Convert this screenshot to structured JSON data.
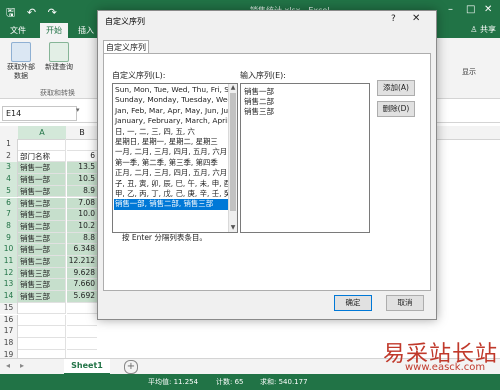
{
  "titlebar": {
    "document_title": "销售统计.xlsx - Excel",
    "qat_icons": [
      "save-icon",
      "undo-icon",
      "redo-icon"
    ]
  },
  "ribbon": {
    "tabs": [
      "文件",
      "开始",
      "插入"
    ],
    "active_tab": "开始",
    "share_label": "共享",
    "buttons": [
      "获取外部数据",
      "新建查询"
    ],
    "group_label": "获取和转换",
    "right_label": "显示"
  },
  "formula_bar": {
    "name_box": "E14"
  },
  "sheet": {
    "col_a_header": "A",
    "col_b_header": "B",
    "rows": [
      {
        "n": "1",
        "a": "",
        "b": ""
      },
      {
        "n": "2",
        "a": "部门名称",
        "b": "6"
      },
      {
        "n": "3",
        "a": "销售一部",
        "b": "13.5"
      },
      {
        "n": "4",
        "a": "销售一部",
        "b": "10.5"
      },
      {
        "n": "5",
        "a": "销售一部",
        "b": "8.9"
      },
      {
        "n": "6",
        "a": "销售二部",
        "b": "7.08"
      },
      {
        "n": "7",
        "a": "销售二部",
        "b": "10.0"
      },
      {
        "n": "8",
        "a": "销售二部",
        "b": "10.2"
      },
      {
        "n": "9",
        "a": "销售二部",
        "b": "8.8"
      },
      {
        "n": "10",
        "a": "销售一部",
        "b": "6.348"
      },
      {
        "n": "11",
        "a": "销售二部",
        "b": "12.212"
      },
      {
        "n": "12",
        "a": "销售三部",
        "b": "9.628"
      },
      {
        "n": "13",
        "a": "销售三部",
        "b": "7.660"
      },
      {
        "n": "14",
        "a": "销售三部",
        "b": "5.692"
      },
      {
        "n": "15",
        "a": "",
        "b": ""
      },
      {
        "n": "16",
        "a": "",
        "b": ""
      },
      {
        "n": "17",
        "a": "",
        "b": ""
      },
      {
        "n": "18",
        "a": "",
        "b": ""
      },
      {
        "n": "19",
        "a": "",
        "b": ""
      }
    ],
    "sheet_tab": "Sheet1",
    "add_sheet": "+"
  },
  "status": {
    "average": "平均值: 11.254",
    "count": "计数: 65",
    "sum": "求和: 540.177"
  },
  "dialog": {
    "title": "自定义序列",
    "help": "?",
    "close": "✕",
    "tab_label": "自定义序列",
    "lists_label": "自定义序列(L):",
    "entries_label": "输入序列(E):",
    "lists": [
      "Sun, Mon, Tue, Wed, Thu, Fri, Sat",
      "Sunday, Monday, Tuesday, Wednesday",
      "Jan, Feb, Mar, Apr, May, Jun, Jul",
      "January, February, March, April",
      "日, 一, 二, 三, 四, 五, 六",
      "星期日, 星期一, 星期二, 星期三",
      "一月, 二月, 三月, 四月, 五月, 六月",
      "第一季, 第二季, 第三季, 第四季",
      "正月, 二月, 三月, 四月, 五月, 六月",
      "子, 丑, 寅, 卯, 辰, 巳, 午, 未, 申, 酉",
      "甲, 乙, 丙, 丁, 戊, 己, 庚, 辛, 壬, 癸",
      "销售一部, 销售二部, 销售三部"
    ],
    "selected_index": 11,
    "entries": [
      "销售一部",
      "销售二部",
      "销售三部"
    ],
    "add_button": "添加(A)",
    "delete_button": "删除(D)",
    "hint": "按 Enter 分隔列表条目。",
    "ok_button": "确定",
    "cancel_button": "取消"
  },
  "watermark": {
    "line1": "易采站长站",
    "line2": "www.easck.com"
  },
  "colors": {
    "excel_green": "#217346",
    "selection_blue": "#0078d7",
    "watermark_red": "#c0392b"
  }
}
